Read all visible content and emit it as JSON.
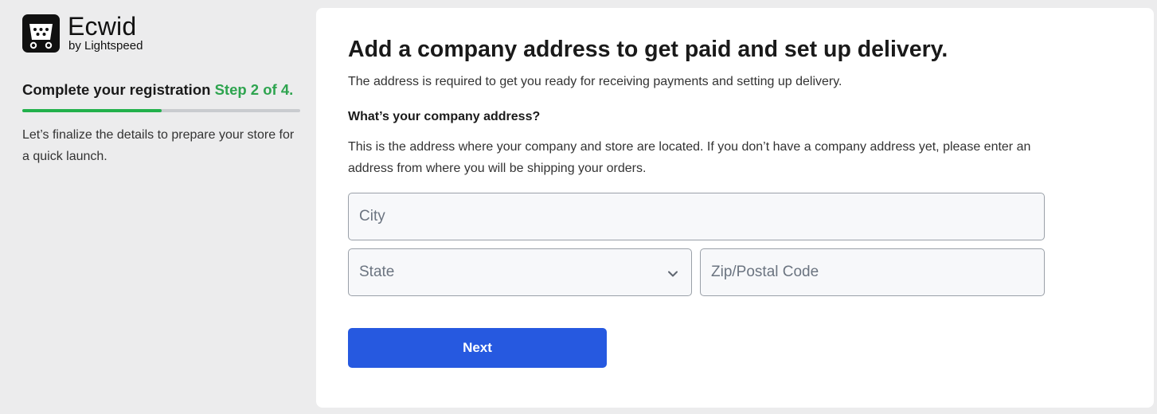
{
  "brand": {
    "name": "Ecwid",
    "sub": "by Lightspeed",
    "icon": "shopping-bag-icon"
  },
  "sidebar": {
    "title": "Complete your registration",
    "step": "Step 2 of 4.",
    "progress": 0.5,
    "description": "Let’s finalize the details to prepare your store for a quick launch."
  },
  "main": {
    "title": "Add a company address to get paid and set up delivery.",
    "subtitle": "The address is required to get you ready for receiving payments and setting up delivery.",
    "question_title": "What’s your company address?",
    "question_desc": "This is the address where your company and store are located. If you don’t have a company address yet, please enter an address from where you will be shipping your orders."
  },
  "form": {
    "city_placeholder": "City",
    "state_placeholder": "State",
    "zip_placeholder": "Zip/Postal Code",
    "state_icon": "chevron-down-icon"
  },
  "actions": {
    "next_label": "Next"
  },
  "colors": {
    "accent": "#2659e0",
    "step_green": "#2ea44f",
    "progress_green": "#22b14c"
  }
}
